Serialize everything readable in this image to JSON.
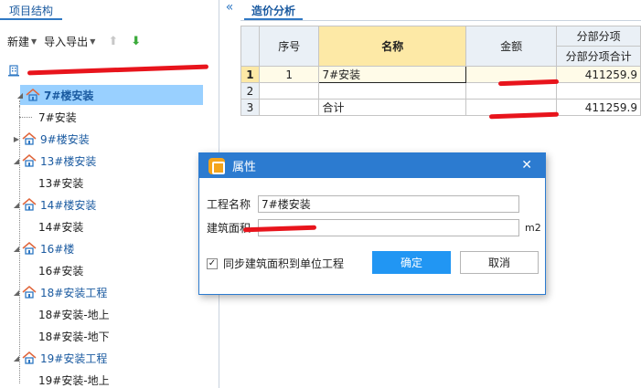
{
  "left_panel": {
    "tab_label": "项目结构",
    "collapse_label": "«",
    "toolbar": {
      "new_label": "新建",
      "import_export_label": "导入导出"
    },
    "root_label": "",
    "tree": [
      {
        "label": "7#楼安装",
        "kind": "unit"
      },
      {
        "label": "7#安装",
        "kind": "leaf"
      },
      {
        "label": "9#楼安装",
        "kind": "unit"
      },
      {
        "label": "13#楼安装",
        "kind": "unit"
      },
      {
        "label": "13#安装",
        "kind": "leaf"
      },
      {
        "label": "14#楼安装",
        "kind": "unit"
      },
      {
        "label": "14#安装",
        "kind": "leaf"
      },
      {
        "label": "16#楼",
        "kind": "unit"
      },
      {
        "label": "16#安装",
        "kind": "leaf"
      },
      {
        "label": "18#安装工程",
        "kind": "unit"
      },
      {
        "label": "18#安装-地上",
        "kind": "leaf"
      },
      {
        "label": "18#安装-地下",
        "kind": "leaf"
      },
      {
        "label": "19#安装工程",
        "kind": "unit"
      },
      {
        "label": "19#安装-地上",
        "kind": "leaf"
      }
    ]
  },
  "right_panel": {
    "tab_label": "造价分析",
    "headers": {
      "seq": "序号",
      "name": "名称",
      "amount": "金额",
      "group": "分部分项",
      "group_total": "分部分项合计"
    },
    "rows": [
      {
        "rownum": "1",
        "seq": "1",
        "name": "7#安装",
        "amount": "",
        "group_total": "411259.9"
      },
      {
        "rownum": "2",
        "seq": "",
        "name": "",
        "amount": "",
        "group_total": ""
      },
      {
        "rownum": "3",
        "seq": "",
        "name": "合计",
        "amount": "",
        "group_total": "411259.9"
      }
    ]
  },
  "dialog": {
    "title": "属性",
    "close_label": "✕",
    "project_name_label": "工程名称",
    "project_name_value": "7#楼安装",
    "area_label": "建筑面积",
    "area_value": "",
    "area_unit": "m2",
    "sync_label": "同步建筑面积到单位工程",
    "ok_label": "确定",
    "cancel_label": "取消"
  },
  "colors": {
    "accent": "#2c7bd0",
    "selected_bg": "#99d0ff",
    "highlight_header": "#fde9a6",
    "redaction": "#e8141c"
  }
}
